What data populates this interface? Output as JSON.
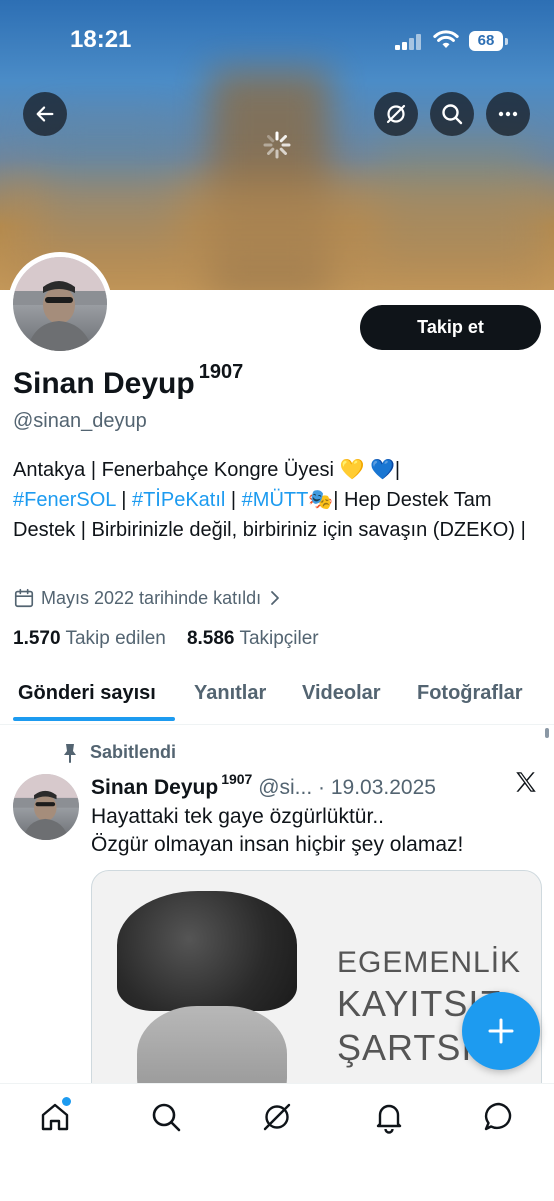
{
  "status_bar": {
    "time": "18:21",
    "battery": "68"
  },
  "profile": {
    "display_name": "Sinan Deyup",
    "name_suffix": "1907",
    "handle": "@sinan_deyup",
    "follow_label": "Takip et",
    "bio": {
      "line1": "Antakya | Fenerbahçe Kongre Üyesi 💛 💙|",
      "hashtag1": "#FenerSOL",
      "sep1": " | ",
      "hashtag2": "#TİPeKatıl",
      "sep2": " | ",
      "hashtag3": "#MÜTT",
      "emoji": "🎭",
      "rest": "| Hep Destek Tam Destek | Birbirinizle değil, birbiriniz için savaşın (DZEKO) |"
    },
    "joined": "Mayıs 2022 tarihinde katıldı",
    "following_count": "1.570",
    "following_label": "Takip edilen",
    "followers_count": "8.586",
    "followers_label": "Takipçiler"
  },
  "tabs": [
    "Gönderi sayısı",
    "Yanıtlar",
    "Videolar",
    "Fotoğraflar"
  ],
  "pinned_tweet": {
    "pinned_label": "Sabitlendi",
    "author": "Sinan Deyup",
    "author_suffix": "1907",
    "handle_date": "@si... · 19.03.2025",
    "text": "Hayattaki tek gaye özgürlüktür..\nÖzgür olmayan insan hiçbir şey olamaz!",
    "image_text": [
      "EGEMENLİK",
      "KAYITSIZ",
      "ŞARTSI"
    ]
  },
  "colors": {
    "accent": "#1d9bf0",
    "text": "#0f1419",
    "muted": "#536471"
  },
  "icons": [
    "back-arrow-icon",
    "grok-icon",
    "search-icon",
    "more-icon",
    "calendar-icon",
    "chevron-right-icon",
    "pin-icon",
    "x-logo-icon",
    "plus-icon",
    "home-icon",
    "bell-icon",
    "messages-icon"
  ]
}
